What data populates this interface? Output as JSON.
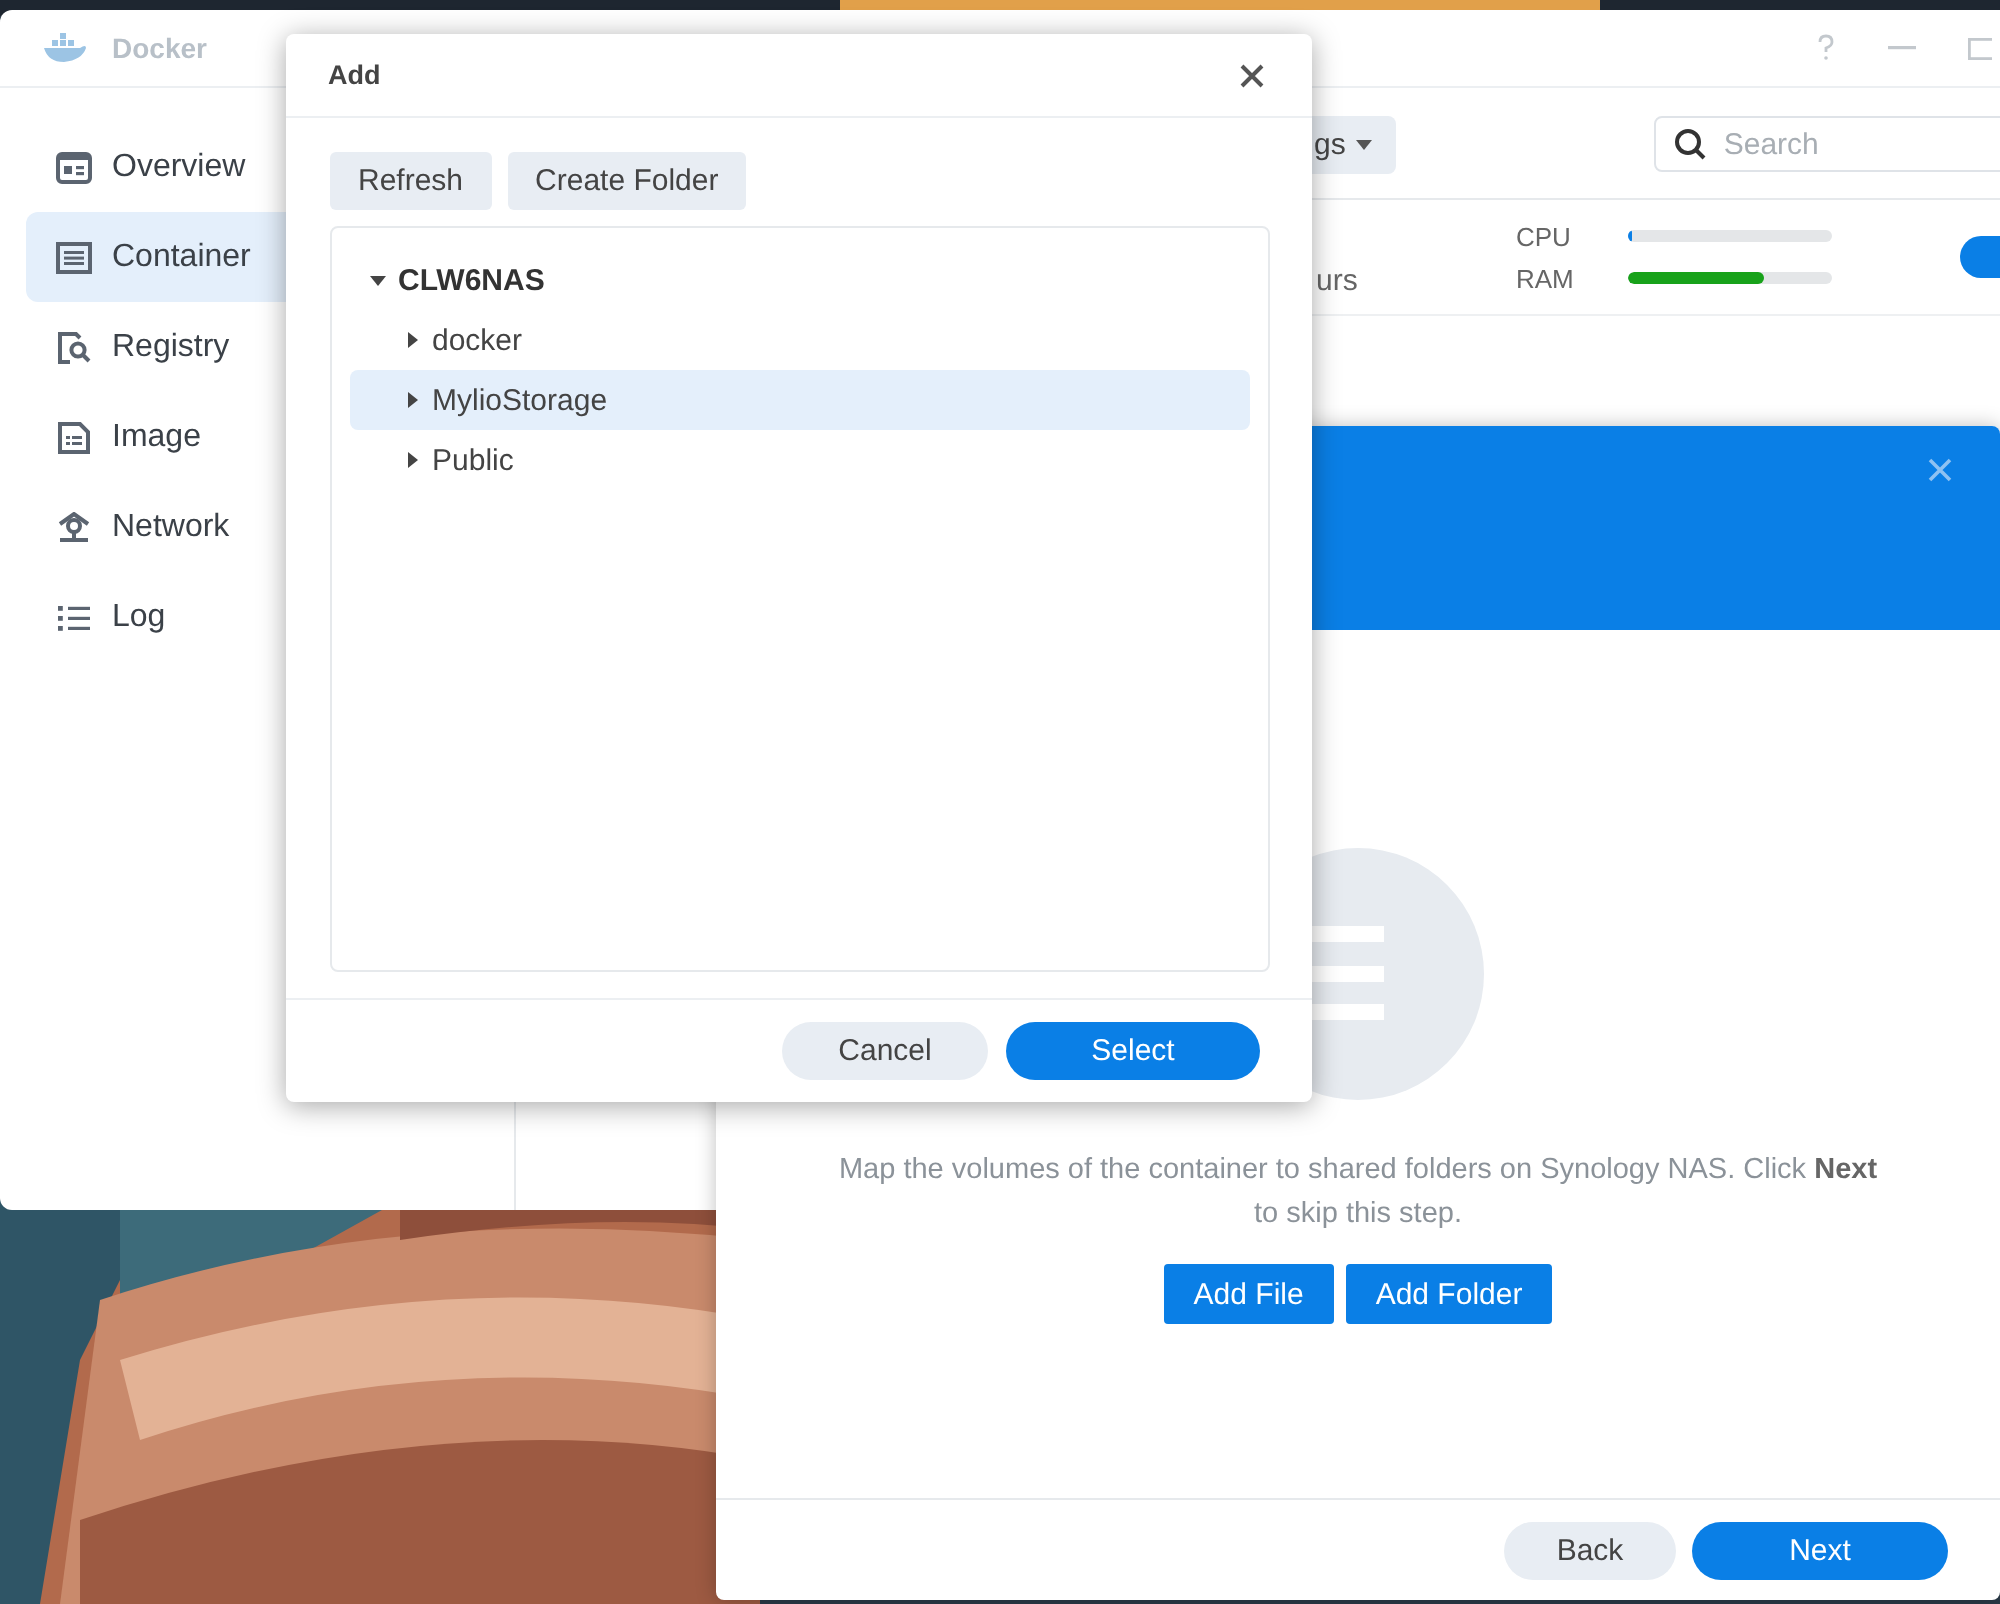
{
  "docker_window": {
    "title": "Docker",
    "sidebar": {
      "items": [
        {
          "label": "Overview",
          "selected": false
        },
        {
          "label": "Container",
          "selected": true
        },
        {
          "label": "Registry",
          "selected": false
        },
        {
          "label": "Image",
          "selected": false
        },
        {
          "label": "Network",
          "selected": false
        },
        {
          "label": "Log",
          "selected": false
        }
      ]
    },
    "toolbar": {
      "settings_button": "gs",
      "search": {
        "placeholder": "Search"
      }
    },
    "container_row": {
      "uptime": "urs",
      "running": true,
      "metrics": [
        {
          "label": "CPU",
          "level": 0.02,
          "color": "#0a7fe6"
        },
        {
          "label": "RAM",
          "level": 0.67,
          "color": "#18a21a"
        }
      ]
    }
  },
  "volume_wizard": {
    "description": "Map the volumes of the container to shared folders on Synology NAS. Click **Next** to skip this step.",
    "buttons": [
      "Add File",
      "Add Folder"
    ],
    "footer_buttons": [
      {
        "label": "Back",
        "kind": "secondary"
      },
      {
        "label": "Next",
        "kind": "primary"
      }
    ]
  },
  "add_dialog": {
    "title": "Add",
    "toolbar_buttons": [
      "Refresh",
      "Create Folder"
    ],
    "tree": [
      {
        "label": "CLW6NAS",
        "expanded": true,
        "selected": false,
        "children": [
          {
            "label": "docker",
            "expanded": false,
            "selected": false
          },
          {
            "label": "MylioStorage",
            "expanded": false,
            "selected": true
          },
          {
            "label": "Public",
            "expanded": false,
            "selected": false
          }
        ]
      }
    ],
    "buttons": [
      {
        "label": "Cancel",
        "kind": "secondary"
      },
      {
        "label": "Select",
        "kind": "primary"
      }
    ]
  }
}
